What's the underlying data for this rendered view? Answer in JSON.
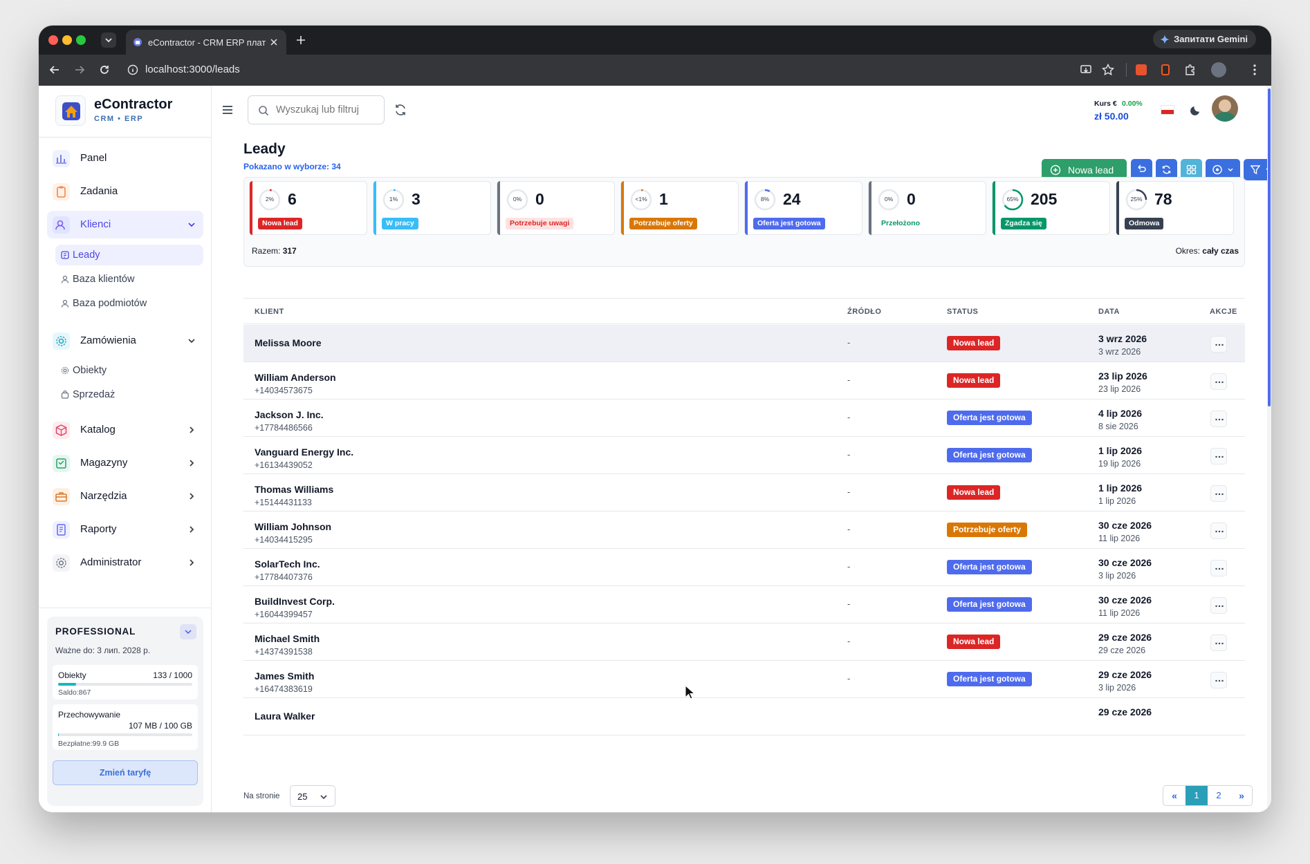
{
  "browser": {
    "tab_title": "eContractor - CRM ERP платф",
    "url": "localhost:3000/leads",
    "gemini_label": "Запитати Gemini"
  },
  "brand": {
    "name": "eContractor",
    "subtitle": "CRM • ERP"
  },
  "sidebar": {
    "items": [
      {
        "label": "Panel",
        "icon": "chart-icon"
      },
      {
        "label": "Zadania",
        "icon": "clipboard-icon"
      },
      {
        "label": "Klienci",
        "icon": "users-icon",
        "expanded": true
      },
      {
        "label": "Zamówienia",
        "icon": "gear-icon",
        "expanded": true
      },
      {
        "label": "Katalog",
        "icon": "box-icon"
      },
      {
        "label": "Magazyny",
        "icon": "warehouse-icon"
      },
      {
        "label": "Narzędzia",
        "icon": "toolbox-icon"
      },
      {
        "label": "Raporty",
        "icon": "report-icon"
      },
      {
        "label": "Administrator",
        "icon": "admin-gear-icon"
      }
    ],
    "klienci_sub": [
      "Leady",
      "Baza klientów",
      "Baza podmiotów"
    ],
    "zamowienia_sub": [
      "Obiekty",
      "Sprzedaż"
    ]
  },
  "plan": {
    "name": "PROFESSIONAL",
    "valid": "Ważne do: 3 лип. 2028 р.",
    "objects_label": "Obiekty",
    "objects_value": "133 / 1000",
    "objects_fraction": 0.133,
    "objects_balance": "Saldo:867",
    "storage_label": "Przechowywanie",
    "storage_value": "107 MB / 100 GB",
    "storage_fraction": 0.001,
    "storage_free": "Bezpłatne:99.9 GB",
    "change_button": "Zmień taryfę"
  },
  "header": {
    "search_placeholder": "Wyszukaj lub filtruj",
    "rate_label": "Kurs €",
    "rate_change": "0.00%",
    "rate_value": "zł 50.00"
  },
  "page": {
    "title": "Leady",
    "shown_label": "Pokazano w wyborze:",
    "shown_count": "34",
    "new_lead_button": "Nowa lead"
  },
  "stats": [
    {
      "pct": "2%",
      "fraction": 0.02,
      "count": "6",
      "label": "Nowa lead",
      "color": "#dc2626",
      "pill_bg": "#dc2626",
      "pill_fg": "#ffffff"
    },
    {
      "pct": "1%",
      "fraction": 0.01,
      "count": "3",
      "label": "W pracy",
      "color": "#38bdf8",
      "pill_bg": "#38bdf8",
      "pill_fg": "#ffffff"
    },
    {
      "pct": "0%",
      "fraction": 0.0,
      "count": "0",
      "label": "Potrzebuje uwagi",
      "color": "#6b7280",
      "pill_bg": "#fee2e2",
      "pill_fg": "#dc2626"
    },
    {
      "pct": "<1%",
      "fraction": 0.005,
      "count": "1",
      "label": "Potrzebuje oferty",
      "color": "#d97706",
      "pill_bg": "#d97706",
      "pill_fg": "#ffffff"
    },
    {
      "pct": "8%",
      "fraction": 0.08,
      "count": "24",
      "label": "Oferta jest gotowa",
      "color": "#4f6bed",
      "pill_bg": "#4f6bed",
      "pill_fg": "#ffffff"
    },
    {
      "pct": "0%",
      "fraction": 0.0,
      "count": "0",
      "label": "Przełożono",
      "color": "#6b7280",
      "pill_bg": "#ffffff",
      "pill_fg": "#059669"
    },
    {
      "pct": "65%",
      "fraction": 0.65,
      "count": "205",
      "label": "Zgadza się",
      "color": "#059669",
      "pill_bg": "#059669",
      "pill_fg": "#ffffff"
    },
    {
      "pct": "25%",
      "fraction": 0.25,
      "count": "78",
      "label": "Odmowa",
      "color": "#374151",
      "pill_bg": "#374151",
      "pill_fg": "#ffffff"
    }
  ],
  "totals": {
    "label": "Razem:",
    "value": "317",
    "period_label": "Okres:",
    "period_value": "cały czas"
  },
  "table": {
    "headers": [
      "KLIENT",
      "ŹRÓDŁO",
      "STATUS",
      "DATA",
      "AKCJE"
    ],
    "rows": [
      {
        "name": "Melissa Moore",
        "phone": "",
        "source": "-",
        "status": "Nowa lead",
        "status_color": "#dc2626",
        "date": "3 wrz 2026",
        "date2": "3 wrz 2026"
      },
      {
        "name": "William Anderson",
        "phone": "+14034573675",
        "source": "-",
        "status": "Nowa lead",
        "status_color": "#dc2626",
        "date": "23 lip 2026",
        "date2": "23 lip 2026"
      },
      {
        "name": "Jackson J. Inc.",
        "phone": "+17784486566",
        "source": "-",
        "status": "Oferta jest gotowa",
        "status_color": "#4f6bed",
        "date": "4 lip 2026",
        "date2": "8 sie 2026"
      },
      {
        "name": "Vanguard Energy Inc.",
        "phone": "+16134439052",
        "source": "-",
        "status": "Oferta jest gotowa",
        "status_color": "#4f6bed",
        "date": "1 lip 2026",
        "date2": "19 lip 2026"
      },
      {
        "name": "Thomas Williams",
        "phone": "+15144431133",
        "source": "-",
        "status": "Nowa lead",
        "status_color": "#dc2626",
        "date": "1 lip 2026",
        "date2": "1 lip 2026"
      },
      {
        "name": "William Johnson",
        "phone": "+14034415295",
        "source": "-",
        "status": "Potrzebuje oferty",
        "status_color": "#d97706",
        "date": "30 cze 2026",
        "date2": "11 lip 2026"
      },
      {
        "name": "SolarTech Inc.",
        "phone": "+17784407376",
        "source": "-",
        "status": "Oferta jest gotowa",
        "status_color": "#4f6bed",
        "date": "30 cze 2026",
        "date2": "3 lip 2026"
      },
      {
        "name": "BuildInvest Corp.",
        "phone": "+16044399457",
        "source": "-",
        "status": "Oferta jest gotowa",
        "status_color": "#4f6bed",
        "date": "30 cze 2026",
        "date2": "11 lip 2026"
      },
      {
        "name": "Michael Smith",
        "phone": "+14374391538",
        "source": "-",
        "status": "Nowa lead",
        "status_color": "#dc2626",
        "date": "29 cze 2026",
        "date2": "29 cze 2026"
      },
      {
        "name": "James Smith",
        "phone": "+16474383619",
        "source": "-",
        "status": "Oferta jest gotowa",
        "status_color": "#4f6bed",
        "date": "29 cze 2026",
        "date2": "3 lip 2026"
      },
      {
        "name": "Laura Walker",
        "phone": "",
        "source": "",
        "status": "",
        "status_color": "#dc2626",
        "date": "29 cze 2026",
        "date2": ""
      }
    ]
  },
  "pagination": {
    "per_page_label": "Na stronie",
    "per_page_value": "25",
    "prev": "«",
    "pages": [
      "1",
      "2"
    ],
    "current": "1",
    "next": "»"
  }
}
